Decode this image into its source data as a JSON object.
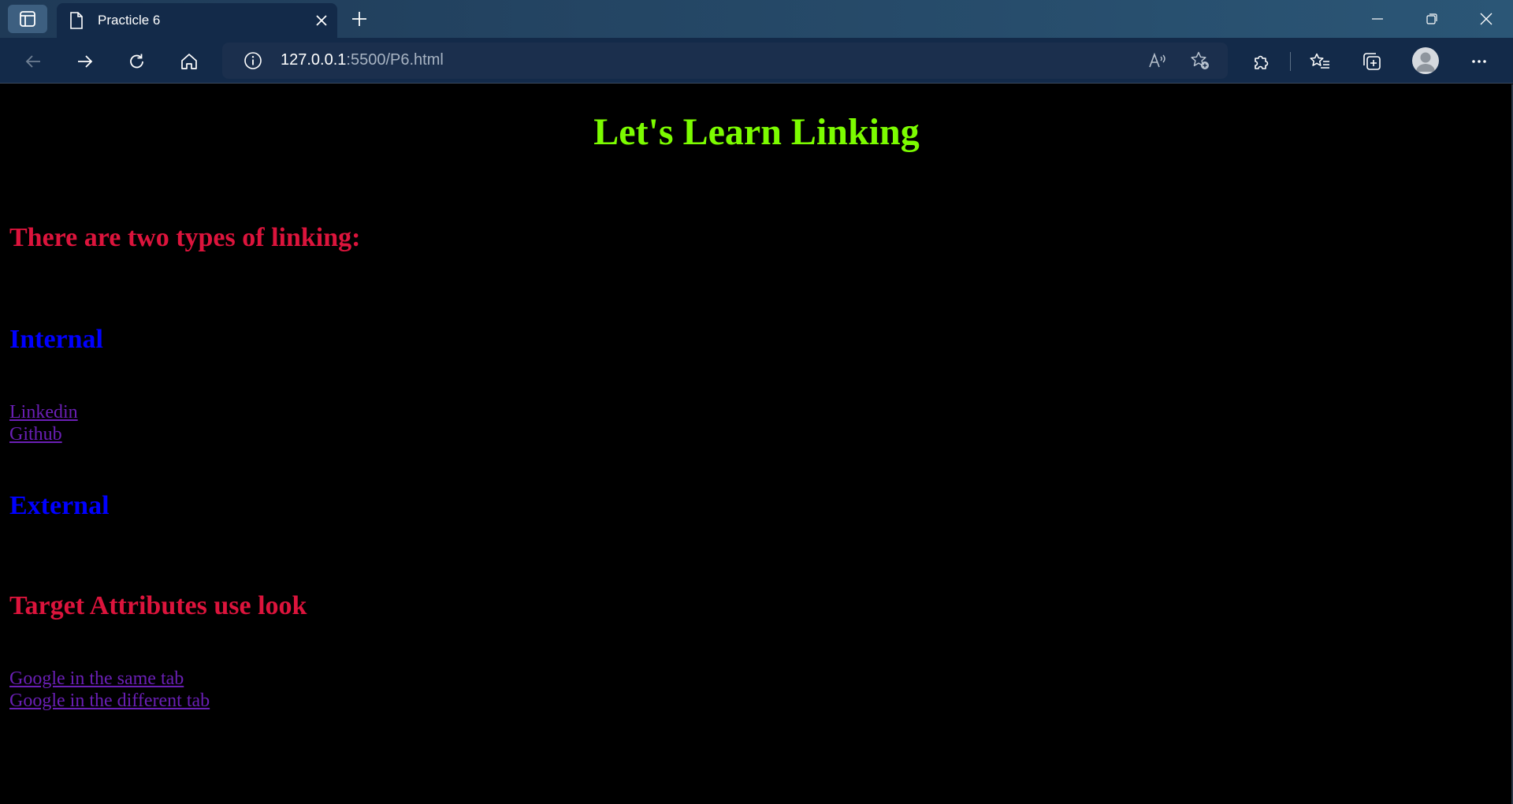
{
  "browser": {
    "tab_title": "Practicle 6",
    "url_host": "127.0.0.1",
    "url_rest": ":5500/P6.html"
  },
  "icons": {
    "tab_actions": "tab-actions-icon",
    "page": "page-icon",
    "close": "close-icon",
    "new_tab": "plus-icon",
    "back": "back-arrow-icon",
    "forward": "forward-arrow-icon",
    "refresh": "refresh-icon",
    "home": "home-icon",
    "info": "info-icon",
    "read_aloud": "read-aloud-icon",
    "add_favorite": "add-favorite-icon",
    "extensions": "puzzle-icon",
    "favorites": "favorites-icon",
    "collections": "collections-icon",
    "profile": "avatar",
    "more": "more-icon"
  },
  "page": {
    "title": "Let's Learn Linking",
    "intro_heading": "There are two types of linking:",
    "internal_heading": "Internal",
    "internal_links": [
      "Linkedin",
      "Github"
    ],
    "external_heading": "External",
    "target_heading": "Target Attributes use look",
    "target_links": [
      "Google in the same tab",
      "Google in the different tab"
    ]
  },
  "colors": {
    "page_title": "#7cfc00",
    "red_heading": "#dc143c",
    "blue_heading": "#0000ff",
    "link": "#6a1fb5",
    "page_background": "#000000"
  }
}
